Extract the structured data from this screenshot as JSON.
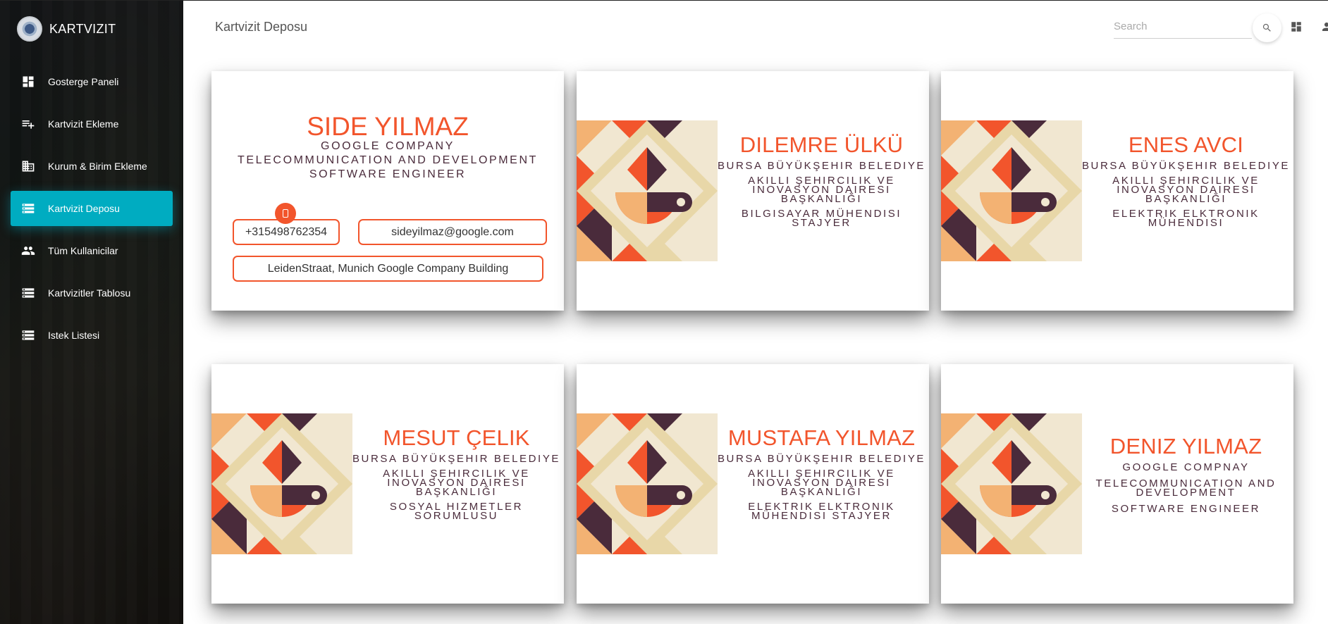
{
  "app": {
    "title": "KARTVIZIT"
  },
  "sidebar": {
    "items": [
      {
        "label": "Gosterge Paneli",
        "icon": "dashboard-icon"
      },
      {
        "label": "Kartvizit Ekleme",
        "icon": "playlist-add-icon"
      },
      {
        "label": "Kurum & Birim Ekleme",
        "icon": "building-icon"
      },
      {
        "label": "Kartvizit Deposu",
        "icon": "storage-icon",
        "active": true
      },
      {
        "label": "Tüm Kullanicilar",
        "icon": "people-icon"
      },
      {
        "label": "Kartvizitler Tablosu",
        "icon": "storage-icon"
      },
      {
        "label": "Istek Listesi",
        "icon": "storage-icon"
      }
    ]
  },
  "header": {
    "title": "Kartvizit Deposu",
    "search_placeholder": "Search"
  },
  "colors": {
    "accent": "#00acc1",
    "card_name": "#f2552c",
    "card_text": "#4a2b3b"
  },
  "cards": [
    {
      "name": "SIDE YILMAZ",
      "lines": [
        "GOOGLE COMPANY",
        "TELECOMMUNICATION AND DEVELOPMENT",
        "SOFTWARE ENGINEER"
      ],
      "phone": "+315498762354",
      "email": "sideyilmaz@google.com",
      "address": "LeidenStraat, Munich Google Company Building"
    },
    {
      "name": "DILEMRE ÜLKÜ",
      "lines": [
        "BURSA BÜYÜKŞEHIR BELEDIYE",
        "AKILLI ŞEHIRCILIK VE INOVASYON DAIRESI BAŞKANLIĞI",
        "BILGISAYAR MÜHENDISI STAJYER"
      ]
    },
    {
      "name": "ENES AVCI",
      "lines": [
        "BURSA BÜYÜKŞEHIR BELEDIYE",
        "AKILLI ŞEHIRCILIK VE INOVASYON DAIRESI BAŞKANLIĞI",
        "ELEKTRIK ELKTRONIK MÜHENDISI"
      ]
    },
    {
      "name": "MESUT ÇELIK",
      "lines": [
        "BURSA BÜYÜKŞEHIR BELEDIYE",
        "AKILLI ŞEHIRCILIK VE INOVASYON DAIRESI BAŞKANLIĞI",
        "SOSYAL HIZMETLER SORUMLUSU"
      ]
    },
    {
      "name": "MUSTAFA YILMAZ",
      "lines": [
        "BURSA BÜYÜKŞEHIR BELEDIYE",
        "AKILLI ŞEHIRCILIK VE INOVASYON DAIRESI BAŞKANLIĞI",
        "ELEKTRIK ELKTRONIK MÜHENDISI STAJYER"
      ]
    },
    {
      "name": "DENIZ YILMAZ",
      "lines": [
        "GOOGLE COMPNAY",
        "TELECOMMUNICATION AND DEVELOPMENT",
        "SOFTWARE ENGINEER"
      ]
    }
  ]
}
